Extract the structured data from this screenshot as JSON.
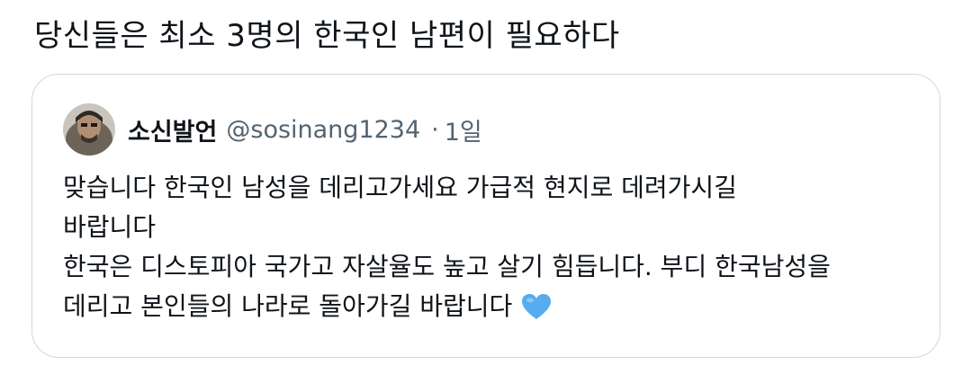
{
  "post": {
    "text": "당신들은 최소 3명의 한국인 남편이 필요하다"
  },
  "quote": {
    "author": {
      "display_name": "소신발언",
      "handle": "@sosinang1234",
      "separator": "·",
      "time": "1일"
    },
    "lines": [
      "맞습니다 한국인 남성을 데리고가세요 가급적 현지로 데려가시길",
      "바랍니다",
      "한국은 디스토피아 국가고 자살율도 높고 살기 힘듭니다. 부디 한국남성을",
      "데리고 본인들의 나라로 돌아가길 바랍니다"
    ],
    "emoji": "blue-heart",
    "heart_color": "#55acee"
  },
  "colors": {
    "text": "#0f1419",
    "secondary": "#536471",
    "border": "#cfd9de"
  }
}
